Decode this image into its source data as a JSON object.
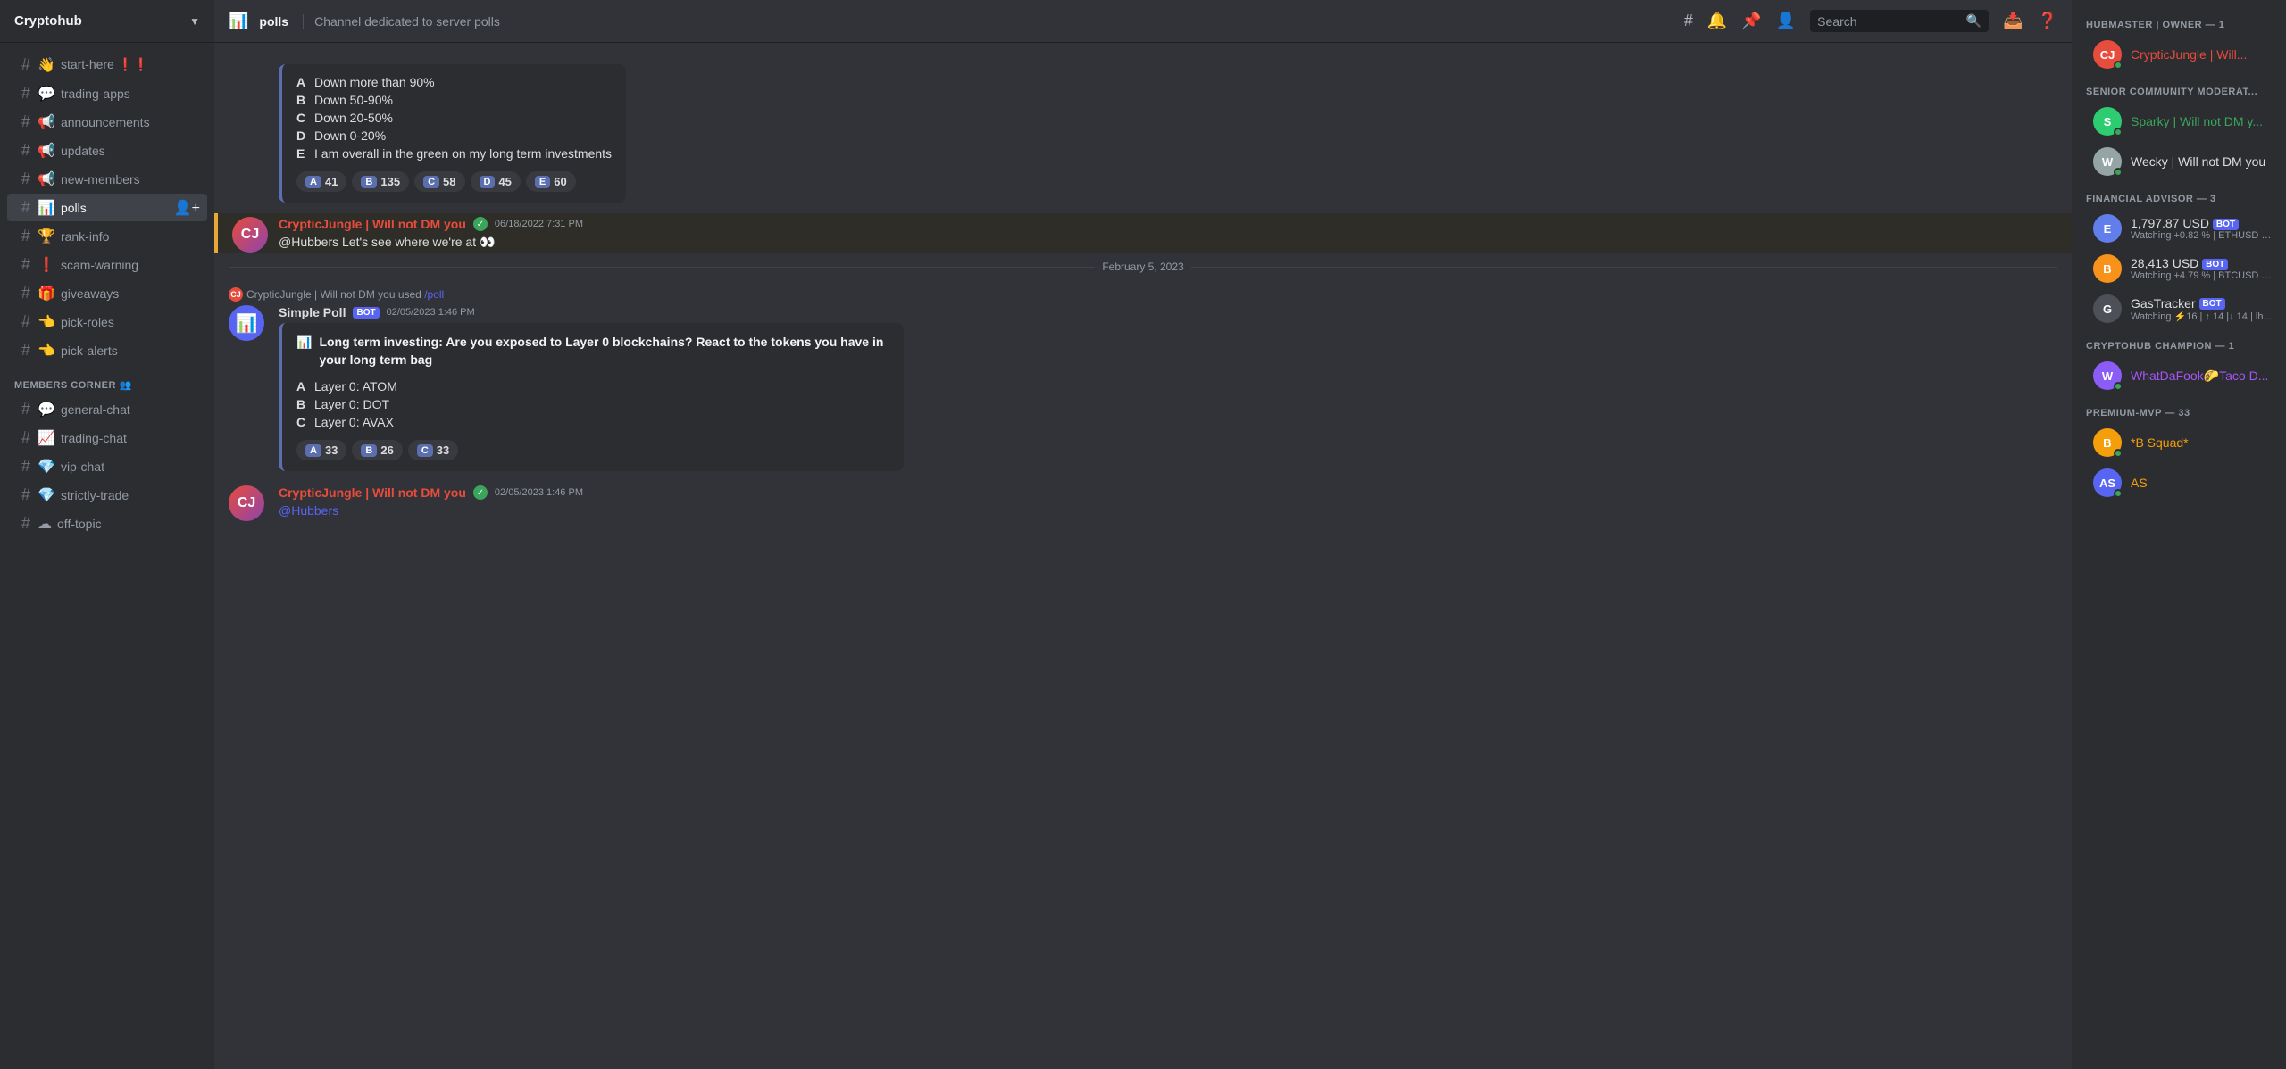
{
  "server": {
    "name": "Cryptohub",
    "chevron": "▼"
  },
  "sidebar": {
    "channels": [
      {
        "id": "start-here",
        "icon": "👋",
        "label": "start-here ❗❗",
        "active": false
      },
      {
        "id": "trading-apps",
        "icon": "💬",
        "label": "trading-apps",
        "active": false
      },
      {
        "id": "announcements",
        "icon": "📢",
        "label": "announcements",
        "active": false
      },
      {
        "id": "updates",
        "icon": "📢",
        "label": "updates",
        "active": false
      },
      {
        "id": "new-members",
        "icon": "📢",
        "label": "new-members",
        "active": false
      },
      {
        "id": "polls",
        "icon": "📊",
        "label": "polls",
        "active": true
      },
      {
        "id": "rank-info",
        "icon": "🏆",
        "label": "rank-info",
        "active": false
      },
      {
        "id": "scam-warning",
        "icon": "❗",
        "label": "scam-warning",
        "active": false
      },
      {
        "id": "giveaways",
        "icon": "🎁",
        "label": "giveaways",
        "active": false
      },
      {
        "id": "pick-roles",
        "icon": "👈",
        "label": "pick-roles",
        "active": false
      },
      {
        "id": "pick-alerts",
        "icon": "👈",
        "label": "pick-alerts",
        "active": false
      }
    ],
    "sections": [
      {
        "id": "members-corner",
        "label": "MEMBERS CORNER 👥",
        "channels": [
          {
            "id": "general-chat",
            "icon": "💬",
            "label": "general-chat",
            "active": false
          },
          {
            "id": "trading-chat",
            "icon": "📈",
            "label": "trading-chat",
            "active": false
          },
          {
            "id": "vip-chat",
            "icon": "💎",
            "label": "vip-chat",
            "active": false
          },
          {
            "id": "strictly-trade",
            "icon": "💎",
            "label": "strictly-trade",
            "active": false
          },
          {
            "id": "off-topic",
            "icon": "☁",
            "label": "off-topic",
            "active": false
          }
        ]
      }
    ]
  },
  "header": {
    "channel_icon": "📊",
    "channel_name": "polls",
    "channel_desc": "Channel dedicated to server polls",
    "search_placeholder": "Search"
  },
  "messages": [
    {
      "id": "msg1",
      "type": "poll_result",
      "poll_options": [
        {
          "letter": "A",
          "text": "Down more than 90%"
        },
        {
          "letter": "B",
          "text": "Down 50-90%"
        },
        {
          "letter": "C",
          "text": "Down 20-50%"
        },
        {
          "letter": "D",
          "text": "Down 0-20%"
        },
        {
          "letter": "E",
          "text": "I am overall in the green on my long term investments"
        }
      ],
      "votes": [
        {
          "letter": "A",
          "count": "41"
        },
        {
          "letter": "B",
          "count": "135"
        },
        {
          "letter": "C",
          "count": "58"
        },
        {
          "letter": "D",
          "count": "45"
        },
        {
          "letter": "E",
          "count": "60"
        }
      ]
    },
    {
      "id": "msg2",
      "type": "message",
      "author": "CrypticJungle | Will not DM you",
      "author_class": "author-crypticjungle",
      "avatar_class": "avatar-crypticjungle",
      "avatar_initials": "CJ",
      "verified": true,
      "timestamp": "06/18/2022 7:31 PM",
      "content": "@Hubbers Let's see where we're at 👀"
    },
    {
      "id": "msg3",
      "type": "date_divider",
      "date": "February 5, 2023"
    },
    {
      "id": "msg4",
      "type": "poll_message",
      "used_by": "CrypticJungle | Will not DM you",
      "command": "/poll",
      "bot_name": "Simple Poll",
      "bot_icon": "📊",
      "timestamp": "02/05/2023 1:46 PM",
      "poll_title": "Long term investing: Are you exposed to Layer 0 blockchains? React to the tokens you have in your long term bag",
      "poll_options": [
        {
          "letter": "A",
          "text": "Layer 0: ATOM"
        },
        {
          "letter": "B",
          "text": "Layer 0: DOT"
        },
        {
          "letter": "C",
          "text": "Layer 0: AVAX"
        }
      ],
      "votes": [
        {
          "letter": "A",
          "count": "33"
        },
        {
          "letter": "B",
          "count": "26"
        },
        {
          "letter": "C",
          "count": "33"
        }
      ]
    },
    {
      "id": "msg5",
      "type": "message",
      "author": "CrypticJungle | Will not DM you",
      "author_class": "author-crypticjungle",
      "avatar_class": "avatar-crypticjungle",
      "avatar_initials": "CJ",
      "verified": true,
      "timestamp": "02/05/2023 1:46 PM",
      "content": "@Hubbers"
    }
  ],
  "right_sidebar": {
    "roles": [
      {
        "id": "hubmaster",
        "label": "HUBMASTER | OWNER — 1",
        "members": [
          {
            "id": "crypticjungle",
            "name": "CrypticJungle | Will...",
            "avatar_bg": "#e74c3c",
            "initials": "CJ",
            "status": "online",
            "name_class": "owner",
            "dot_color": "#eb459e"
          }
        ]
      },
      {
        "id": "senior-mod",
        "label": "SENIOR COMMUNITY MODERAT...",
        "members": [
          {
            "id": "sparky",
            "name": "Sparky | Will not DM y...",
            "avatar_bg": "#2ecc71",
            "initials": "S",
            "status": "online",
            "name_class": "mod"
          },
          {
            "id": "wecky",
            "name": "Wecky | Will not DM you",
            "avatar_bg": "#95a5a6",
            "initials": "W",
            "status": "online",
            "name_class": "advisor"
          }
        ]
      },
      {
        "id": "financial-advisor",
        "label": "FINANCIAL ADVISOR — 3",
        "members": [
          {
            "id": "eth-tracker",
            "name": "1,797.87 USD",
            "sub": "Watching +0.82 % | ETHUSD |...",
            "avatar_bg": "#627eea",
            "initials": "E",
            "bot": true,
            "name_class": "advisor"
          },
          {
            "id": "btc-tracker",
            "name": "28,413 USD",
            "sub": "Watching +4.79 % | BTCUSD |...",
            "avatar_bg": "#f7931a",
            "initials": "B",
            "bot": true,
            "name_class": "advisor"
          },
          {
            "id": "gas-tracker",
            "name": "GasTracker",
            "sub": "Watching ⚡16 | ↑ 14 |↓ 14 | lh...",
            "avatar_bg": "#4e5058",
            "initials": "G",
            "bot": true,
            "name_class": "advisor"
          }
        ]
      },
      {
        "id": "cryptohub-champion",
        "label": "CRYPTOHUB CHAMPION — 1",
        "members": [
          {
            "id": "whatdafook",
            "name": "WhatDaFook🌮Taco D...",
            "avatar_bg": "#8b5cf6",
            "initials": "W",
            "status": "online",
            "name_class": "champion"
          }
        ]
      },
      {
        "id": "premium-mvp",
        "label": "PREMIUM-MVP — 33",
        "members": [
          {
            "id": "bsquad",
            "name": "*B Squad*",
            "avatar_bg": "#f59e0b",
            "initials": "B",
            "status": "online",
            "name_class": "premium"
          },
          {
            "id": "as",
            "name": "AS",
            "avatar_bg": "#5865f2",
            "initials": "AS",
            "status": "online",
            "name_class": "premium"
          }
        ]
      }
    ]
  }
}
